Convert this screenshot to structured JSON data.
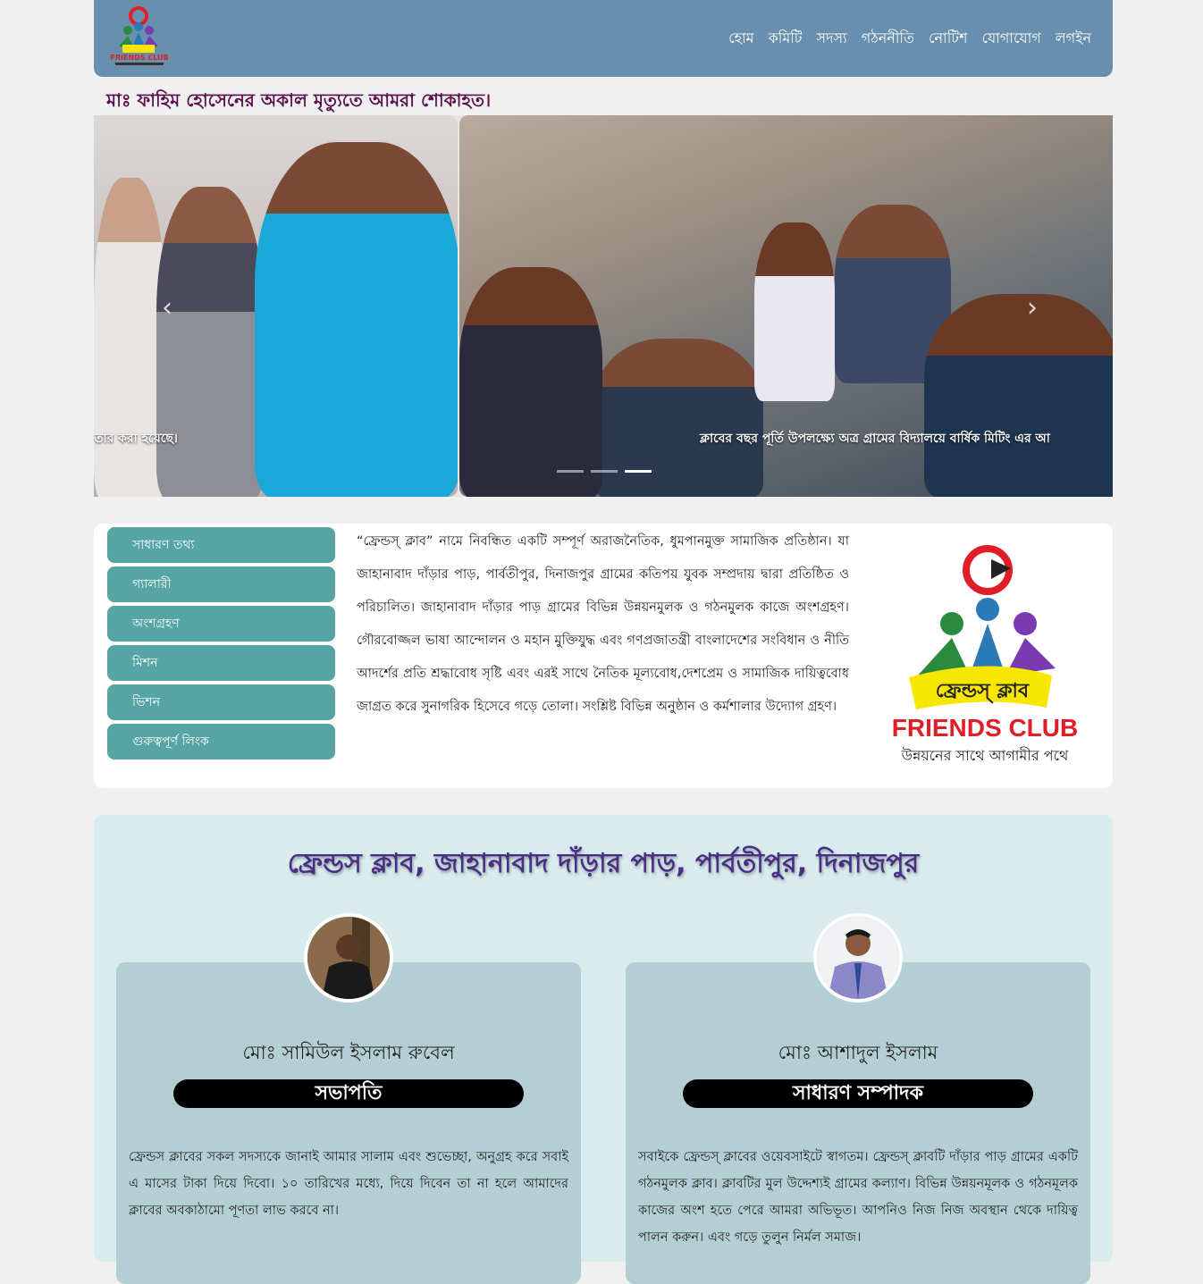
{
  "nav": {
    "items": [
      "হোম",
      "কমিটি",
      "সদস্য",
      "গঠননীতি",
      "নোটিশ",
      "যোগাযোগ",
      "লগইন"
    ]
  },
  "logo": {
    "small_text": "FRIENDS CLUB",
    "big_bn": "ফ্রেন্ডস্‌ ক্লাব",
    "big_en": "FRIENDS CLUB",
    "tagline": "উন্নয়নের সাথে আগামীর পথে"
  },
  "notice": "মাঃ ফাহিম হোসেনের অকাল মৃত্যুতে আমরা শোকাহত।",
  "slider": {
    "left_caption": "তার করা হয়েছে।",
    "right_caption": "ক্লাবের বছর পূর্তি উপলক্ষ্যে অত্র গ্রামের বিদ্যালয়ে বার্ষিক মিটিং এর আ",
    "prev_label": "‹",
    "next_label": "›",
    "slides_total": 3,
    "active_slide": 3
  },
  "sidemenu": [
    "সাধারণ তথ্য",
    "গ্যালারী",
    "অংশগ্রহণ",
    "মিশন",
    "ভিশন",
    "গুরুত্বপূর্ণ লিংক"
  ],
  "about": "“ফ্রেন্ডস্‌ ক্লাব” নামে নিবন্ধিত একটি সম্পূর্ণ অরাজনৈতিক, ধুমপানমুক্ত সামাজিক প্রতিষ্ঠান। যা জাহানাবাদ দাঁড়ার পাড়, পার্বতীপুর, দিনাজপুর গ্রামের কতিপয় যুবক সম্প্রদায় দ্বারা প্রতিষ্ঠিত ও পরিচালিত। জাহানাবাদ দাঁড়ার পাড় গ্রামের বিভিন্ন উন্নয়নমুলক ও গঠনমুলক কাজে অংশগ্রহণ। গৌরবোজ্জল ভাষা আন্দোলন ও মহান মুক্তিযুদ্ধ এবং গণপ্রজাতন্ত্রী বাংলাদেশের সংবিধান ও নীতি আদর্শের প্রতি শ্রদ্ধাবোধ সৃষ্টি এবং এরই সাথে নৈতিক মূল্যবোধ,দেশপ্রেম ও সামাজিক দায়িত্ববোধ জাগ্রত করে সুনাগরিক হিসেবে গড়ে তোলা। সংশ্লিষ্ট বিভিন্ন অনুষ্ঠান ও কর্মশালার উদ্যোগ গ্রহণ।",
  "leaders": {
    "heading": "ফ্রেন্ডস ক্লাব, জাহানাবাদ দাঁড়ার পাড়, পার্বতীপুর, দিনাজপুর",
    "cards": [
      {
        "name": "মোঃ সামিউল ইসলাম রুবেল",
        "role": "সভাপতি",
        "message": "ফ্রেন্ডস ক্লাবের সকল সদস্যকে জানাই আমার সালাম এবং শুভেচ্ছা, অনুগ্রহ করে সবাই এ মাসের টাকা দিয়ে দিবো। ১০ তারিখের মধ্যে, দিয়ে দিবেন তা না হলে আমাদের ক্লাবের অবকাঠামো পূণতা লাভ করবে না।"
      },
      {
        "name": "মোঃ আশাদুল ইসলাম",
        "role": "সাধারণ সম্পাদক",
        "message": "সবাইকে ফ্রেন্ডস্‌ ক্লাবের ওয়েবসাইটে স্বাগতম। ফ্রেন্ডস্‌ ক্লাবটি দাঁড়ার পাড় গ্রামের একটি গঠনমুলক ক্লাব। ক্লাবটির মুল উদ্দেশ্যই গ্রামের কল্যাণ। বিভিন্ন উন্নয়নমূলক ও গঠনমূলক কাজের অংশ হতে পেরে আমরা অভিভূত। আপনিও নিজ নিজ অবস্থান থেকে দায়িত্ব পালন করুন। এবং গড়ে তুলুন নির্মল সমাজ।"
      }
    ]
  },
  "colors": {
    "navbar": "#6890ae",
    "notice": "#5a0f4e",
    "sidemenu": "#56a4a4",
    "leaders_bg": "#d8ecee",
    "card_bg": "#b4cfd3",
    "heading": "#4a2e86"
  }
}
